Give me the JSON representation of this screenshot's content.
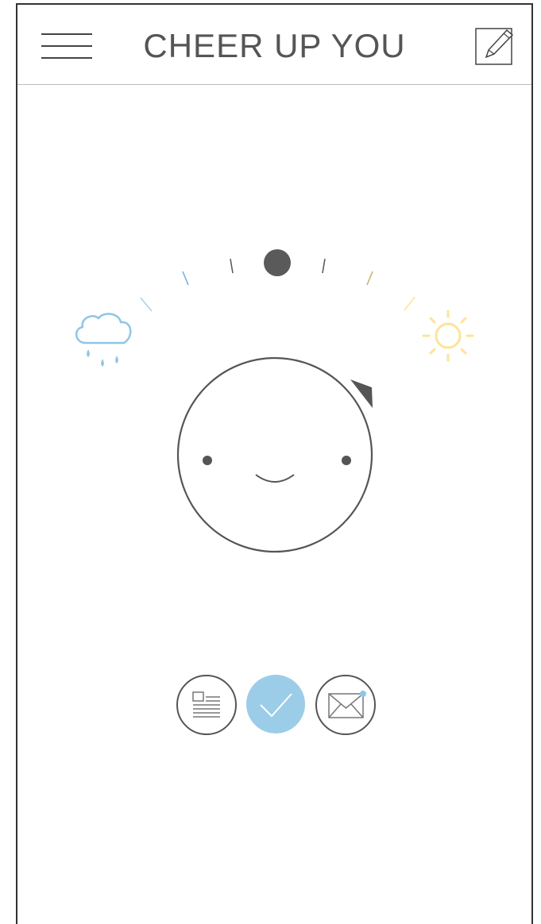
{
  "header": {
    "title": "CHEER UP YOU",
    "menu_icon": "hamburger-menu-icon",
    "edit_icon": "edit-pencil-icon"
  },
  "mood": {
    "left_icon": "rain-cloud-icon",
    "right_icon": "sun-icon",
    "face_icon": "smiley-face-icon",
    "cloud_color": "#8fc6e6",
    "sun_color": "#fbe596",
    "dial_color": "#5a5a5a"
  },
  "actions": [
    {
      "name": "news-icon",
      "active": false
    },
    {
      "name": "check-icon",
      "active": true,
      "color": "#9ccde8"
    },
    {
      "name": "mail-icon",
      "active": false,
      "badge_color": "#8fc6e6"
    }
  ]
}
